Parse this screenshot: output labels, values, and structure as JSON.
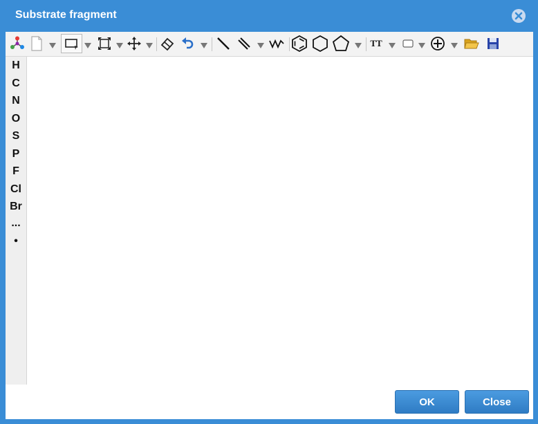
{
  "dialog": {
    "title": "Substrate fragment",
    "buttons": {
      "ok": "OK",
      "close": "Close"
    }
  },
  "toolbar": {
    "tools": [
      {
        "name": "atom-map-icon"
      },
      {
        "name": "new-document-icon"
      },
      {
        "name": "rectangle-select-icon"
      },
      {
        "name": "transform-icon"
      },
      {
        "name": "move-icon"
      },
      {
        "name": "eraser-icon"
      },
      {
        "name": "undo-icon"
      },
      {
        "name": "single-bond-icon"
      },
      {
        "name": "double-bond-icon"
      },
      {
        "name": "chain-icon"
      },
      {
        "name": "benzene-icon"
      },
      {
        "name": "cyclohexane-icon"
      },
      {
        "name": "cyclopentane-icon"
      },
      {
        "name": "text-icon"
      },
      {
        "name": "shape-icon"
      },
      {
        "name": "charge-plus-icon"
      },
      {
        "name": "open-folder-icon"
      },
      {
        "name": "save-icon"
      }
    ],
    "text_tool_label": "TT"
  },
  "sidebar": {
    "elements": [
      "H",
      "C",
      "N",
      "O",
      "S",
      "P",
      "F",
      "Cl",
      "Br",
      "...",
      "•"
    ]
  },
  "colors": {
    "title_bar": "#3a8dd6",
    "button": "#3a8ad0",
    "panel": "#efefef"
  }
}
